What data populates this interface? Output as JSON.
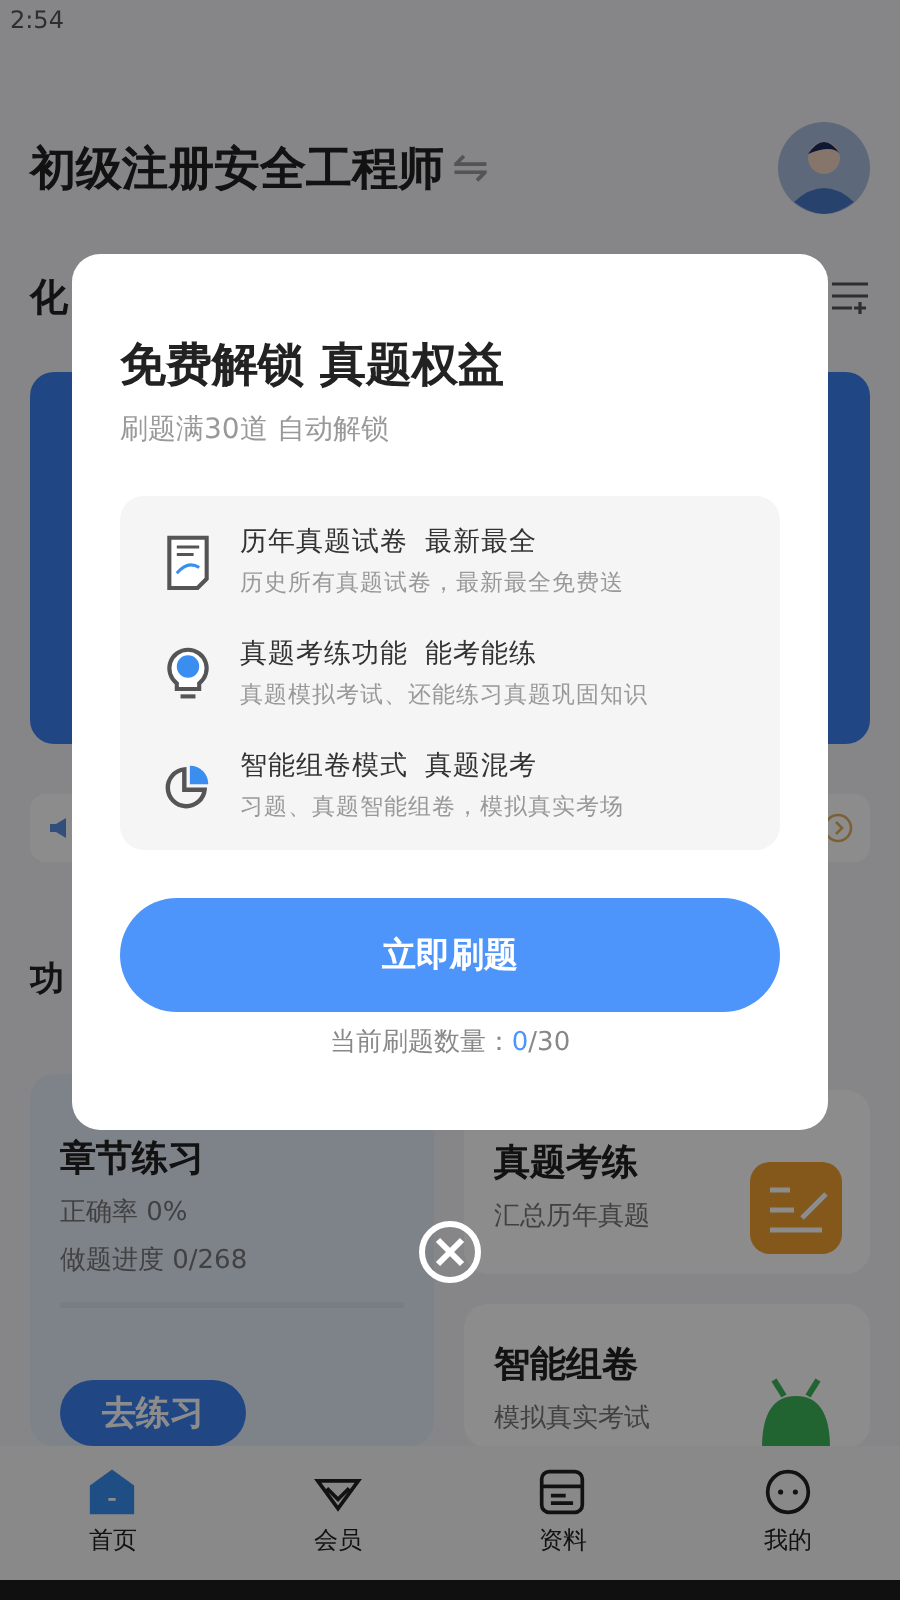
{
  "status_bar": {
    "time": "2:54"
  },
  "header": {
    "title": "初级注册安全工程师",
    "swap_icon": "⇋"
  },
  "subject_tab": {
    "label": "化"
  },
  "section_title": "功",
  "chapter_card": {
    "title": "章节练习",
    "accuracy": "正确率 0%",
    "progress_text": "做题进度 0/268",
    "level": 0,
    "button": "去练习"
  },
  "side_cards": [
    {
      "kind": "exam",
      "title": "真题考练",
      "subtitle": "汇总历年真题"
    },
    {
      "kind": "paper",
      "title": "智能组卷",
      "subtitle": "模拟真实考试"
    }
  ],
  "bottom_nav": [
    {
      "kind": "home",
      "label": "首页",
      "selected": true
    },
    {
      "kind": "vip",
      "label": "会员",
      "selected": false
    },
    {
      "kind": "docs",
      "label": "资料",
      "selected": false
    },
    {
      "kind": "me",
      "label": "我的",
      "selected": false
    }
  ],
  "modal": {
    "title": "免费解锁 真题权益",
    "subtitle": "刷题满30道 自动解锁",
    "features": [
      {
        "kind": "paper",
        "title": "历年真题试卷  最新最全",
        "desc": "历史所有真题试卷，最新最全免费送"
      },
      {
        "kind": "bulb",
        "title": "真题考练功能  能考能练",
        "desc": "真题模拟考试、还能练习真题巩固知识"
      },
      {
        "kind": "pie",
        "title": "智能组卷模式  真题混考",
        "desc": "习题、真题智能组卷，模拟真实考场"
      }
    ],
    "button": "立即刷题",
    "count_label": "当前刷题数量：",
    "count_current": "0",
    "count_total": "/30"
  }
}
